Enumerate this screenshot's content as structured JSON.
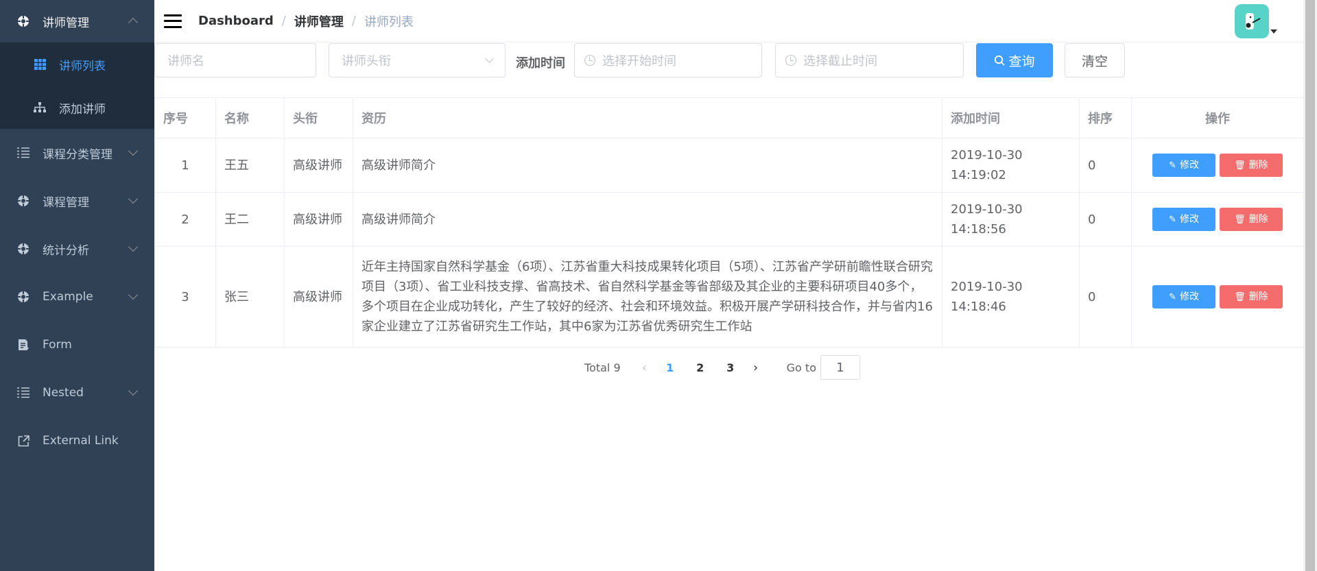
{
  "sidebar": {
    "items": [
      {
        "label": "讲师管理",
        "icon": "gear-icon",
        "expanded": true,
        "children": [
          {
            "label": "讲师列表",
            "icon": "table-icon",
            "active": true
          },
          {
            "label": "添加讲师",
            "icon": "tree-icon",
            "active": false
          }
        ]
      },
      {
        "label": "课程分类管理",
        "icon": "list-icon"
      },
      {
        "label": "课程管理",
        "icon": "gear-icon"
      },
      {
        "label": "统计分析",
        "icon": "gear-icon"
      },
      {
        "label": "Example",
        "icon": "gear-icon"
      },
      {
        "label": "Form",
        "icon": "form-icon"
      },
      {
        "label": "Nested",
        "icon": "list-icon"
      },
      {
        "label": "External Link",
        "icon": "external-link-icon"
      }
    ]
  },
  "breadcrumb": [
    "Dashboard",
    "讲师管理",
    "讲师列表"
  ],
  "filter": {
    "name_placeholder": "讲师名",
    "level_placeholder": "讲师头衔",
    "time_label": "添加时间",
    "start_placeholder": "选择开始时间",
    "end_placeholder": "选择截止时间",
    "query_label": "查询",
    "clear_label": "清空"
  },
  "table": {
    "headers": [
      "序号",
      "名称",
      "头衔",
      "资历",
      "添加时间",
      "排序",
      "操作"
    ],
    "rows": [
      {
        "index": "1",
        "name": "王五",
        "title": "高级讲师",
        "intro": "高级讲师简介",
        "time": "2019-10-30 14:19:02",
        "sort": "0"
      },
      {
        "index": "2",
        "name": "王二",
        "title": "高级讲师",
        "intro": "高级讲师简介",
        "time": "2019-10-30 14:18:56",
        "sort": "0"
      },
      {
        "index": "3",
        "name": "张三",
        "title": "高级讲师",
        "intro": "近年主持国家自然科学基金（6项）、江苏省重大科技成果转化项目（5项）、江苏省产学研前瞻性联合研究项目（3项）、省工业科技支撑、省高技术、省自然科学基金等省部级及其企业的主要科研项目40多个，多个项目在企业成功转化，产生了较好的经济、社会和环境效益。积极开展产学研科技合作，并与省内16家企业建立了江苏省研究生工作站，其中6家为江苏省优秀研究生工作站",
        "time": "2019-10-30 14:18:46",
        "sort": "0"
      }
    ],
    "edit_label": "修改",
    "delete_label": "删除"
  },
  "pagination": {
    "total": "Total 9",
    "pages": [
      "1",
      "2",
      "3"
    ],
    "current": "1",
    "goto_label": "Go to",
    "goto_value": "1"
  },
  "colors": {
    "sidebar_bg": "#304156",
    "submenu_bg": "#1f2d3d",
    "accent": "#409eff",
    "danger": "#f56c6c"
  }
}
